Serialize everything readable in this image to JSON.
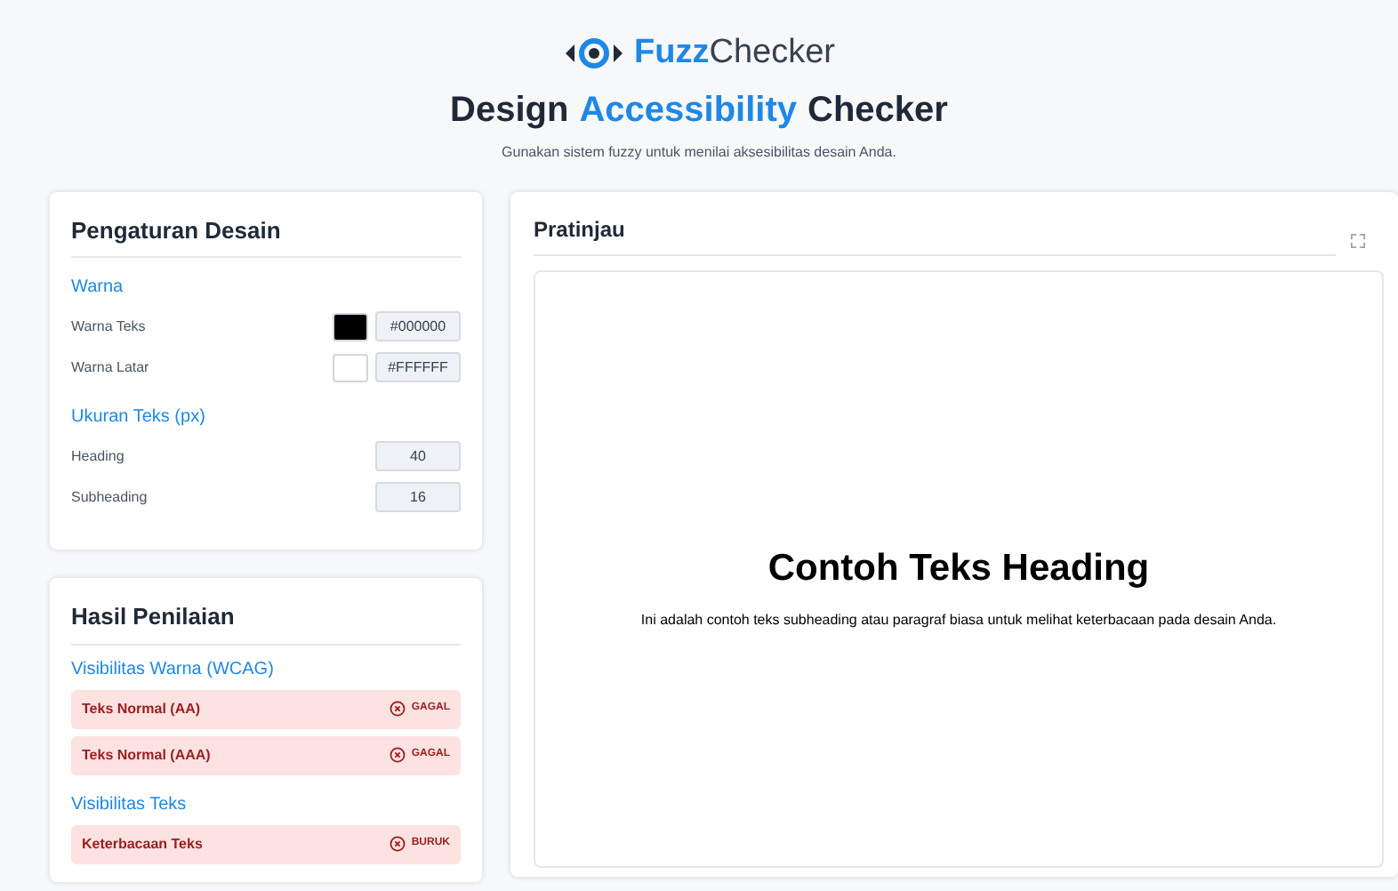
{
  "header": {
    "logo": [
      {
        "text": "Fuzz",
        "highlight": true
      },
      {
        "text": "Checker",
        "highlight": false
      }
    ],
    "title": [
      {
        "text": "Design",
        "highlight": false
      },
      {
        "text": "Accessibility",
        "highlight": true
      },
      {
        "text": "Checker",
        "highlight": false
      }
    ],
    "subtitle": "Gunakan sistem fuzzy untuk menilai aksesibilitas desain Anda."
  },
  "settings": {
    "title": "Pengaturan Desain",
    "sections": [
      {
        "heading": "Warna",
        "rows": [
          {
            "kind": "color",
            "label": "Warna Teks",
            "value": "#000000"
          },
          {
            "kind": "color",
            "label": "Warna Latar",
            "value": "#FFFFFF"
          }
        ]
      },
      {
        "heading": "Ukuran Teks (px)",
        "rows": [
          {
            "kind": "number",
            "label": "Heading",
            "value": "40"
          },
          {
            "kind": "number",
            "label": "Subheading",
            "value": "16"
          }
        ]
      }
    ]
  },
  "results": {
    "title": "Hasil Penilaian",
    "sections": [
      {
        "heading": "Visibilitas Warna (WCAG)",
        "items": [
          {
            "label": "Teks Normal (AA)",
            "verdict": "GAGAL",
            "passed": false
          },
          {
            "label": "Teks Normal (AAA)",
            "verdict": "GAGAL",
            "passed": false
          }
        ]
      },
      {
        "heading": "Visibilitas Teks",
        "items": [
          {
            "label": "Keterbacaan Teks",
            "verdict": "BURUK",
            "passed": false
          }
        ]
      }
    ]
  },
  "preview": {
    "title": "Pratinjau",
    "heading": "Contoh Teks Heading",
    "text": "Ini adalah contoh teks subheading atau paragraf biasa untuk melihat keterbacaan pada desain Anda."
  }
}
